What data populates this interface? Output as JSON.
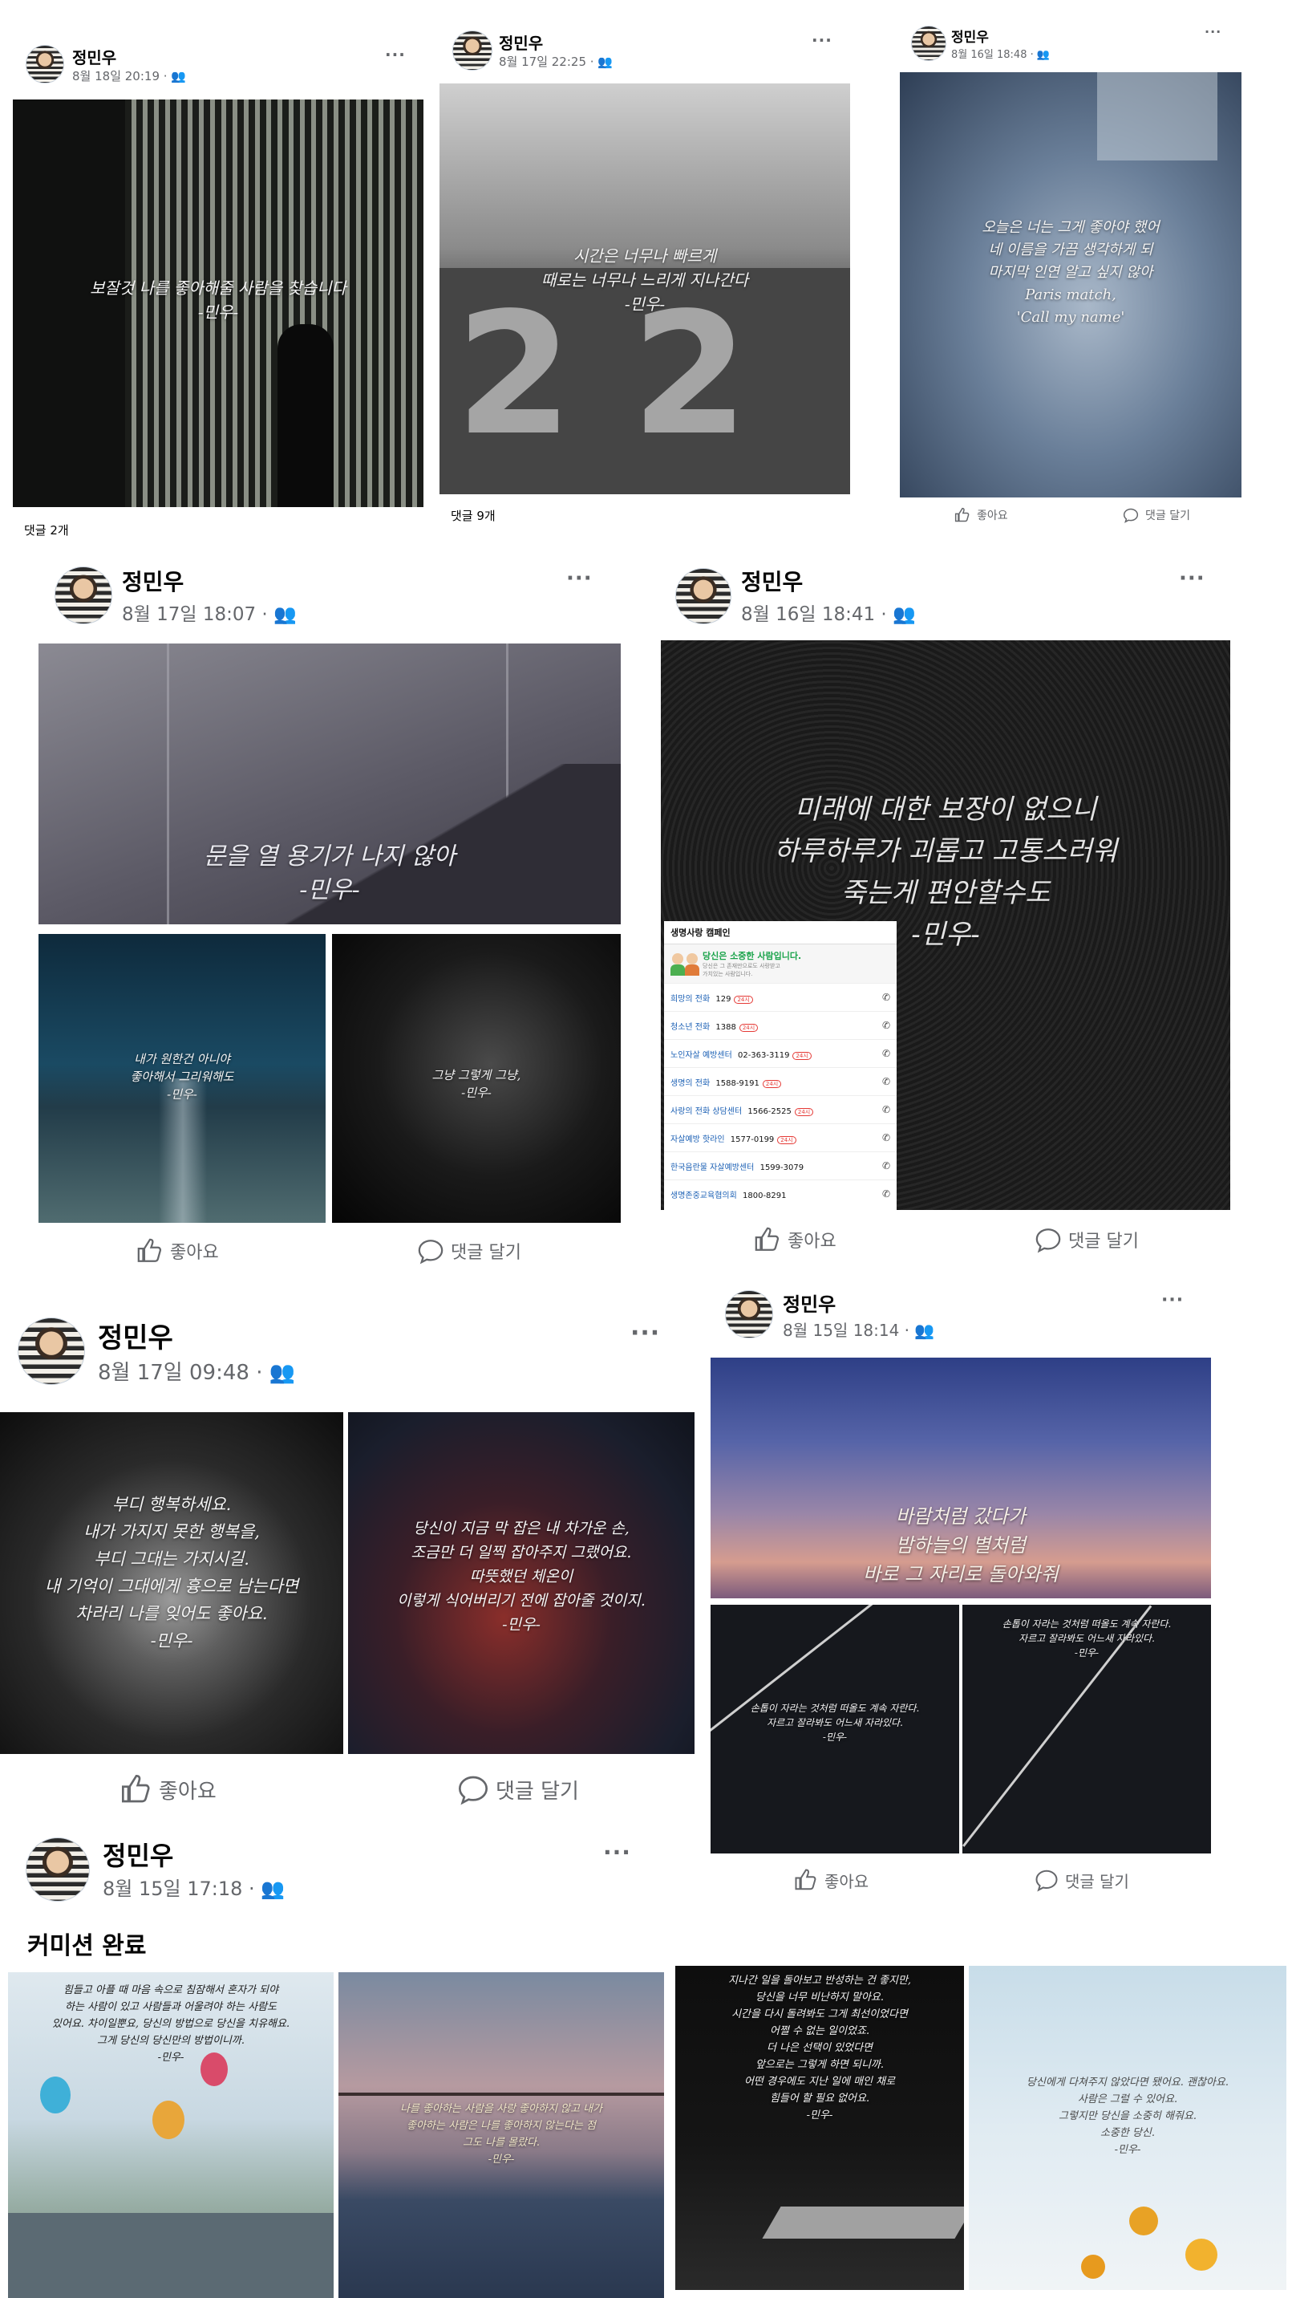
{
  "author": "정민우",
  "more": "···",
  "like": "좋아요",
  "comment": "댓글 달기",
  "posts": [
    {
      "date": "8월 18일 20:19",
      "comments": "댓글 2개",
      "overlay": "보잘것 나를 좋아해줄 사람을 찾습니다\n-민우-"
    },
    {
      "date": "8월 17일 22:25",
      "comments": "댓글 9개",
      "overlay": "시간은 너무나 빠르게\n때로는 너무나 느리게 지나간다\n-민우-"
    },
    {
      "date": "8월 16일 18:48",
      "overlay": "오늘은 너는 그게 좋아야 했어\n네 이름을 가끔 생각하게 되\n마지막 인연 알고 싶지 않아\nParis match,\n'Call my name'"
    },
    {
      "date": "8월 17일 18:07",
      "overlay1": "문을 열 용기가 나지 않아\n-민우-",
      "overlay2": "내가 원한건 아니야\n좋아해서 그리워해도\n-민우-",
      "overlay3": "그냥 그렇게 그냥,\n-민우-"
    },
    {
      "date": "8월 16일 18:41",
      "overlay": "미래에 대한 보장이 없으니\n하루하루가 괴롭고 고통스러워\n죽는게 편안할수도\n-민우-",
      "hotline": {
        "title": "생명사랑 캠페인",
        "headline": "당신은 소중한 사람입니다.",
        "sub": "당신은 그 존재만으로도 사랑받고\n가치있는 사람입니다.",
        "badge": "24시",
        "rows": [
          {
            "name": "희망의 전화",
            "num": "129",
            "badge": true
          },
          {
            "name": "청소년 전화",
            "num": "1388",
            "badge": true
          },
          {
            "name": "노인자살 예방센터",
            "num": "02-363-3119",
            "badge": true
          },
          {
            "name": "생명의 전화",
            "num": "1588-9191",
            "badge": true
          },
          {
            "name": "사랑의 전화 상담센터",
            "num": "1566-2525",
            "badge": true
          },
          {
            "name": "자살예방 핫라인",
            "num": "1577-0199",
            "badge": true
          },
          {
            "name": "한국음란물 자살예방센터",
            "num": "1599-3079",
            "badge": false
          },
          {
            "name": "생명존중교육협의회",
            "num": "1800-8291",
            "badge": false
          }
        ]
      }
    },
    {
      "date": "8월 17일 09:48",
      "overlay1": "부디 행복하세요.\n내가 가지지 못한 행복을,\n부디 그대는 가지시길.\n내 기억이 그대에게 흉으로 남는다면\n차라리 나를 잊어도 좋아요.\n-민우-",
      "overlay2": "당신이 지금 막 잡은 내 차가운 손,\n조금만 더 일찍 잡아주지 그랬어요.\n따뜻했던 체온이\n이렇게 식어버리기 전에 잡아줄 것이지.\n-민우-"
    },
    {
      "date": "8월 15일 18:14",
      "overlay1": "바람처럼 갔다가\n밤하늘의 별처럼\n바로 그 자리로 돌아와줘",
      "overlay2": "손톱이 자라는 것처럼 떠올도 계속 자란다.\n자르고 잘라봐도 어느새 자라있다.\n-민우-",
      "overlay3": "손톱이 자라는 것처럼 떠올도 계속 자란다.\n자르고 잘라봐도 어느새 자라있다.\n-민우-"
    },
    {
      "date": "8월 15일 17:18",
      "text": "커미션 완료",
      "overlay1": "힘들고 아플 때 마음 속으로 침잠해서 혼자가 되야\n하는 사람이 있고 사람들과 어울려야 하는 사람도\n있어요. 차이일뿐요, 당신의 방법으로 당신을 치유해요.\n그게 당신의 당신만의 방법이니까.\n-민우-",
      "overlay2": "나를 좋아하는 사람을 사랑 좋아하지 않고 내가\n좋아하는 사람은 나를 좋아하지 않는다는 점\n그도 나를 몰랐다.\n-민우-"
    },
    {
      "overlay1": "지나간 일을 돌아보고 반성하는 건 좋지만,\n당신을 너무 비난하지 말아요.\n시간을 다시 돌려봐도 그게 최선이었다면\n어쩔 수 없는 일이었죠.\n더 나은 선택이 있었다면\n앞으로는 그렇게 하면 되니까.\n어떤 경우에도 지난 일에 매인 채로\n힘들어 할 필요 없어요.\n-민우-",
      "overlay2": "당신에게 다쳐주지 않았다면 됐어요. 괜찮아요.\n사람은 그럴 수 있어요.\n그렇지만 당신을 소중히 해줘요.\n소중한 당신.\n-민우-"
    }
  ]
}
